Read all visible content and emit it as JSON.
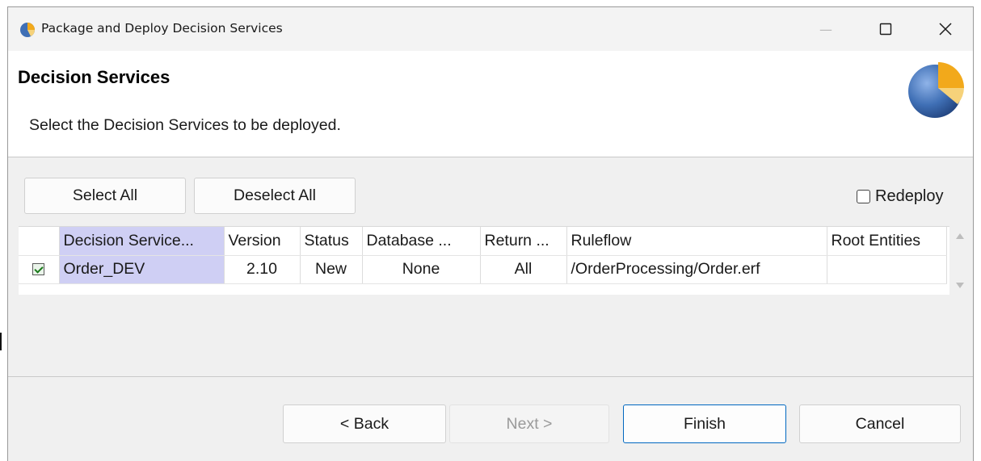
{
  "window": {
    "title": "Package and Deploy Decision Services",
    "controls": {
      "minimize": "—",
      "maximize": "☐",
      "close": "✕"
    },
    "app_icon": "eclipse-pie-icon"
  },
  "header": {
    "title": "Decision Services",
    "description": "Select the Decision Services to be deployed.",
    "logo_icon": "eclipse-pie-logo-icon"
  },
  "toolbar": {
    "select_all_label": "Select All",
    "deselect_all_label": "Deselect All",
    "redeploy_label": "Redeploy",
    "redeploy_checked": false
  },
  "table": {
    "columns": [
      "",
      "Decision Service...",
      "Version",
      "Status",
      "Database ...",
      "Return ...",
      "Ruleflow",
      "Root Entities"
    ],
    "rows": [
      {
        "checked": true,
        "decision_service": "Order_DEV",
        "version": "2.10",
        "status": "New",
        "database": "None",
        "return": "All",
        "ruleflow": "/OrderProcessing/Order.erf",
        "root_entities": ""
      }
    ],
    "sorted_column_color": "#cfcff4"
  },
  "footer": {
    "back_label": "< Back",
    "next_label": "Next >",
    "finish_label": "Finish",
    "cancel_label": "Cancel"
  },
  "colors": {
    "accent": "#0067c0",
    "dialog_bg": "#f0f0f0",
    "selection": "#cfcff4"
  }
}
